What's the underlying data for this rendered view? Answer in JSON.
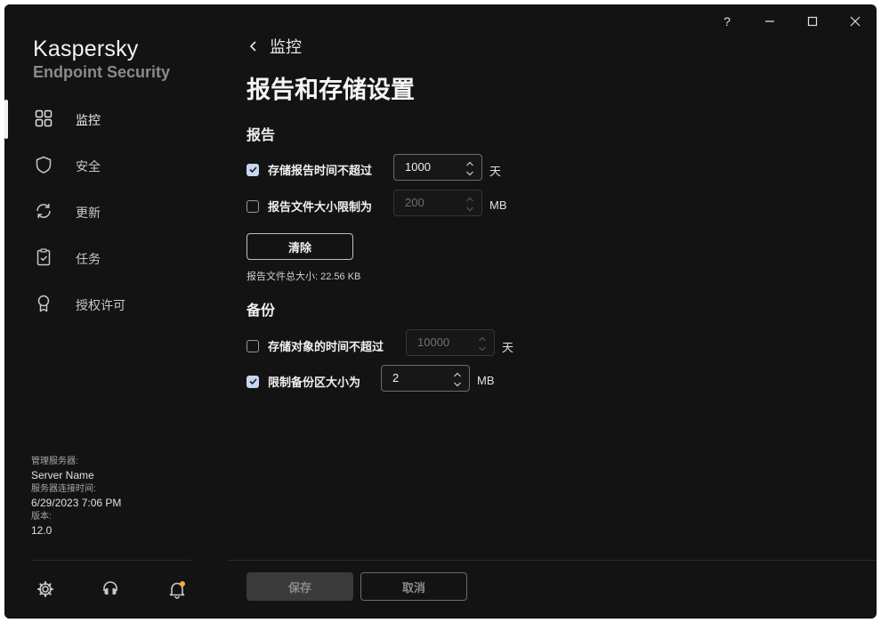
{
  "app": {
    "brand_name": "Kaspersky",
    "brand_product": "Endpoint Security"
  },
  "titlebar": {
    "help": "?",
    "minimize": "—",
    "maximize": "☐",
    "close": "✕"
  },
  "sidebar": {
    "items": [
      {
        "label": "监控",
        "icon": "dashboard-icon",
        "active": true
      },
      {
        "label": "安全",
        "icon": "shield-icon",
        "active": false
      },
      {
        "label": "更新",
        "icon": "refresh-icon",
        "active": false
      },
      {
        "label": "任务",
        "icon": "clipboard-icon",
        "active": false
      },
      {
        "label": "授权许可",
        "icon": "license-icon",
        "active": false
      }
    ],
    "server_info": {
      "server_label": "管理服务器:",
      "server_value": "Server Name",
      "connect_label": "服务器连接时间:",
      "connect_value": "6/29/2023 7:06 PM",
      "version_label": "版本:",
      "version_value": "12.0"
    },
    "bottom_icons": [
      "gear-icon",
      "support-icon",
      "notification-bell-icon"
    ]
  },
  "main": {
    "breadcrumb": "监控",
    "title": "报告和存储设置",
    "reports": {
      "title": "报告",
      "store_checked": true,
      "store_label": "存储报告时间不超过",
      "store_value": "1000",
      "store_unit": "天",
      "size_checked": false,
      "size_label": "报告文件大小限制为",
      "size_value": "200",
      "size_unit": "MB",
      "clear_button": "清除",
      "total_size": "报告文件总大小: 22.56 KB"
    },
    "backup": {
      "title": "备份",
      "store_checked": false,
      "store_label": "存储对象的时间不超过",
      "store_value": "10000",
      "store_unit": "天",
      "limit_checked": true,
      "limit_label": "限制备份区大小为",
      "limit_value": "2",
      "limit_unit": "MB"
    }
  },
  "footer": {
    "save": "保存",
    "cancel": "取消"
  },
  "colors": {
    "background": "#131313",
    "checkbox_checked": "#c6d6f3",
    "notification_dot": "#f0b429"
  }
}
